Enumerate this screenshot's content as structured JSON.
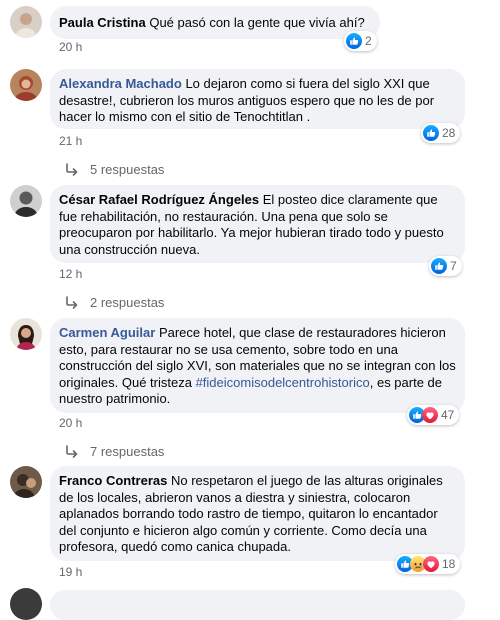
{
  "comments": [
    {
      "author": "Paula Cristina",
      "text": "Qué pasó con la gente que vivía ahí?",
      "time": "20 h",
      "reaction_count": "2",
      "reactions": [
        "like-icon"
      ]
    },
    {
      "author": "Alexandra Machado",
      "text": "Lo dejaron como si fuera del siglo XXI que desastre!, cubrieron los muros antiguos espero que no les de por hacer lo mismo con el sitio de Tenochtitlan .",
      "time": "21 h",
      "reaction_count": "28",
      "reactions": [
        "like-icon"
      ],
      "replies": "5 respuestas"
    },
    {
      "author": "César Rafael Rodríguez Ángeles",
      "text": "El posteo dice claramente que fue rehabilitación, no restauración. Una pena que solo se preocuparon por habilitarlo. Ya mejor hubieran tirado todo y puesto una construcción nueva.",
      "time": "12 h",
      "reaction_count": "7",
      "reactions": [
        "like-icon"
      ],
      "replies": "2 respuestas"
    },
    {
      "author": "Carmen Aguilar",
      "text": "Parece hotel, que clase de restauradores hicieron esto, para restaurar no se usa cemento, sobre todo en una construcción del siglo XVI, son materiales que no se integran con los originales. Qué tristeza ",
      "hashtag": "#fideicomisodelcentrohistorico",
      "text_after": ", es parte de nuestro patrimonio.",
      "time": "20 h",
      "reaction_count": "47",
      "reactions": [
        "like-icon",
        "love-icon"
      ],
      "replies": "7 respuestas"
    },
    {
      "author": "Franco Contreras",
      "text": "No respetaron el juego de las alturas originales de los locales, abrieron vanos a diestra y siniestra, colocaron aplanados borrando todo rastro de tiempo, quitaron lo encantador del conjunto e hicieron algo común y corriente. Como decía una profesora, quedó como canica chupada.",
      "time": "19 h",
      "reaction_count": "18",
      "reactions": [
        "like-icon",
        "sad-icon",
        "love-icon"
      ]
    }
  ],
  "colors": {
    "bubble": "#f0f2f5",
    "link": "#385898",
    "meta": "#65676b",
    "like": "#1877f2",
    "love": "#f33e58",
    "sad": "#f7b125"
  }
}
